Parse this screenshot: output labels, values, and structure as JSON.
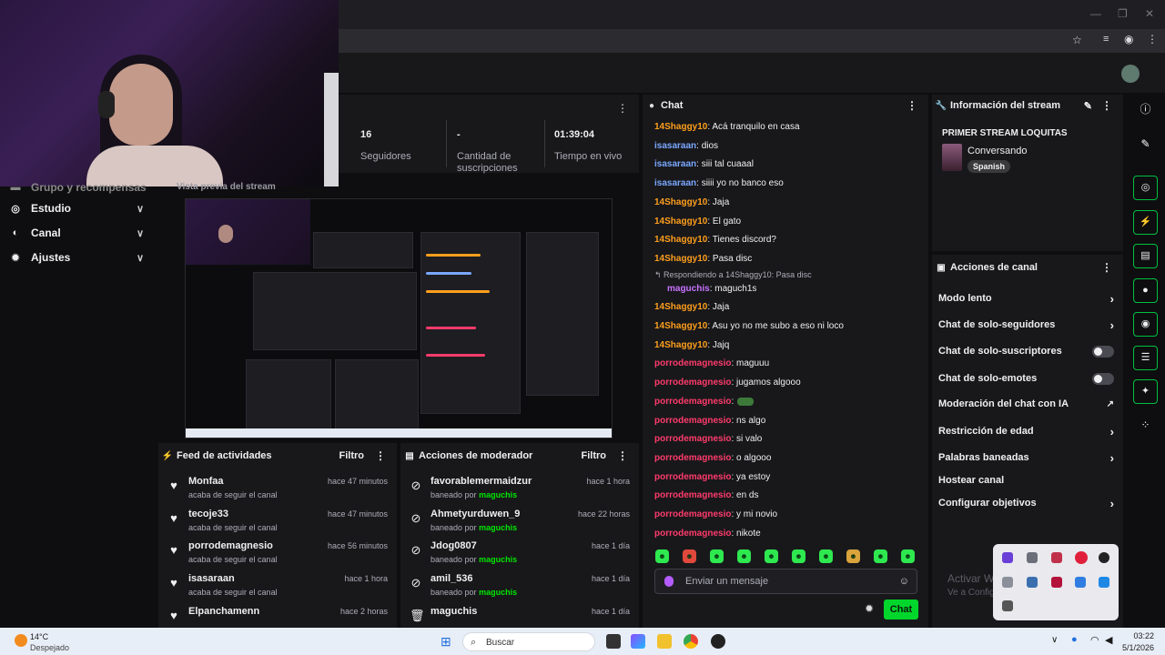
{
  "sidebar": {
    "items": [
      {
        "label": "Grupo y recompensas",
        "icon": "gift-icon"
      },
      {
        "label": "Estudio",
        "icon": "camera-icon"
      },
      {
        "label": "Canal",
        "icon": "broadcast-icon"
      },
      {
        "label": "Ajustes",
        "icon": "gear-icon"
      }
    ]
  },
  "stats": {
    "followers_value": "16",
    "followers_label": "Seguidores",
    "subs_value": "-",
    "subs_label": "Cantidad de suscripciones",
    "live_value": "01:39:04",
    "live_label": "Tiempo en vivo"
  },
  "preview": {
    "label": "Vista previa del stream"
  },
  "activity_feed": {
    "title": "Feed de actividades",
    "filter": "Filtro",
    "items": [
      {
        "name": "Monfaa",
        "sub": "acaba de seguir el canal",
        "time": "hace 47 minutos"
      },
      {
        "name": "tecoje33",
        "sub": "acaba de seguir el canal",
        "time": "hace 47 minutos"
      },
      {
        "name": "porrodemagnesio",
        "sub": "acaba de seguir el canal",
        "time": "hace 56 minutos"
      },
      {
        "name": "isasaraan",
        "sub": "acaba de seguir el canal",
        "time": "hace 1 hora"
      },
      {
        "name": "Elpanchamenn",
        "sub": "",
        "time": "hace 2 horas"
      }
    ]
  },
  "mod_actions": {
    "title": "Acciones de moderador",
    "filter": "Filtro",
    "items": [
      {
        "name": "favorablemermaidzur",
        "sub_prefix": "baneado por",
        "mod": "maguchis",
        "time": "hace 1 hora"
      },
      {
        "name": "Ahmetyurduwen_9",
        "sub_prefix": "baneado por",
        "mod": "maguchis",
        "time": "hace 22 horas"
      },
      {
        "name": "Jdog0807",
        "sub_prefix": "baneado por",
        "mod": "maguchis",
        "time": "hace 1 día"
      },
      {
        "name": "amil_536",
        "sub_prefix": "baneado por",
        "mod": "maguchis",
        "time": "hace 1 día"
      },
      {
        "name": "maguchis",
        "sub_prefix": "",
        "mod": "",
        "time": "hace 1 día"
      }
    ]
  },
  "chat": {
    "title": "Chat",
    "reply_context": "Respondiendo a 14Shaggy10: Pasa disc",
    "messages": [
      {
        "user": "14Shaggy10",
        "text": ": Acá tranquilo en casa",
        "color": "orange"
      },
      {
        "user": "isasaraan",
        "text": ": dios",
        "color": "blue"
      },
      {
        "user": "isasaraan",
        "text": ": siii tal cuaaal",
        "color": "blue"
      },
      {
        "user": "isasaraan",
        "text": ": siiii yo no banco eso",
        "color": "blue"
      },
      {
        "user": "14Shaggy10",
        "text": ": Jaja",
        "color": "orange"
      },
      {
        "user": "14Shaggy10",
        "text": ": El gato",
        "color": "orange"
      },
      {
        "user": "14Shaggy10",
        "text": ": Tienes discord?",
        "color": "orange"
      },
      {
        "user": "14Shaggy10",
        "text": ": Pasa disc",
        "color": "orange"
      },
      {
        "user": "maguchis",
        "text": ": maguch1s",
        "color": "purple"
      },
      {
        "user": "14Shaggy10",
        "text": ": Jaja",
        "color": "orange"
      },
      {
        "user": "14Shaggy10",
        "text": ": Asu yo no me subo a eso ni loco",
        "color": "orange"
      },
      {
        "user": "14Shaggy10",
        "text": ": Jajq",
        "color": "orange"
      },
      {
        "user": "porrodemagnesio",
        "text": ": maguuu",
        "color": "red"
      },
      {
        "user": "porrodemagnesio",
        "text": ": jugamos algooo",
        "color": "red"
      },
      {
        "user": "porrodemagnesio",
        "text": ":",
        "color": "red"
      },
      {
        "user": "porrodemagnesio",
        "text": ": ns algo",
        "color": "red"
      },
      {
        "user": "porrodemagnesio",
        "text": ": si valo",
        "color": "red"
      },
      {
        "user": "porrodemagnesio",
        "text": ": o algooo",
        "color": "red"
      },
      {
        "user": "porrodemagnesio",
        "text": ": ya estoy",
        "color": "red"
      },
      {
        "user": "porrodemagnesio",
        "text": ": en ds",
        "color": "red"
      },
      {
        "user": "porrodemagnesio",
        "text": ": y mi novio",
        "color": "red"
      },
      {
        "user": "porrodemagnesio",
        "text": ": nikote",
        "color": "red"
      }
    ],
    "input_placeholder": "Enviar un mensaje",
    "send_label": "Chat"
  },
  "stream_info": {
    "title": "Información del stream",
    "stream_title": "PRIMER STREAM LOQUITAS",
    "category": "Conversando",
    "language": "Spanish"
  },
  "channel_actions": {
    "title": "Acciones de canal",
    "items": [
      {
        "label": "Modo lento",
        "control": "chevron"
      },
      {
        "label": "Chat de solo-seguidores",
        "control": "chevron"
      },
      {
        "label": "Chat de solo-suscriptores",
        "control": "toggle"
      },
      {
        "label": "Chat de solo-emotes",
        "control": "toggle"
      },
      {
        "label": "Moderación del chat con IA",
        "control": "external"
      },
      {
        "label": "Restricción de edad",
        "control": "chevron"
      },
      {
        "label": "Palabras baneadas",
        "control": "chevron"
      },
      {
        "label": "Hostear canal",
        "control": "none"
      },
      {
        "label": "Configurar objetivos",
        "control": "chevron"
      }
    ]
  },
  "windows": {
    "watermark_title": "Activar Windows",
    "watermark_sub": "Ve a Configuración para activar Windows",
    "weather_temp": "14°C",
    "weather_desc": "Despejado",
    "search_placeholder": "Buscar",
    "clock_time": "03:22",
    "clock_date": "5/1/2026"
  },
  "colors": {
    "accent_green": "#00d62b",
    "panel": "#18181b",
    "background": "#0e0e10"
  }
}
